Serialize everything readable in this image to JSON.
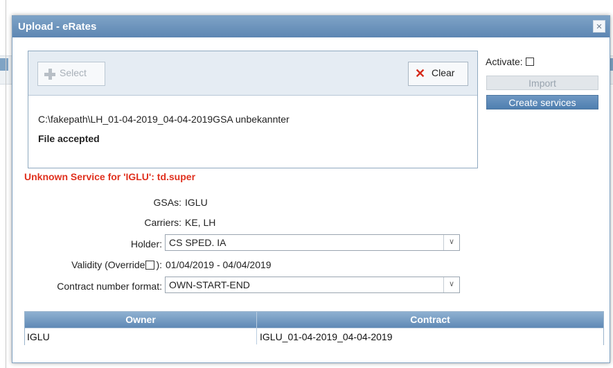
{
  "dialog": {
    "title": "Upload - eRates",
    "close_glyph": "×"
  },
  "upload": {
    "select_label": "Select",
    "clear_label": "Clear",
    "file_path": "C:\\fakepath\\LH_01-04-2019_04-04-2019GSA unbekannter",
    "file_status": "File accepted"
  },
  "side": {
    "activate_label": "Activate:",
    "import_label": "Import",
    "create_services_label": "Create services"
  },
  "error_message": "Unknown Service for 'IGLU': td.super",
  "form": {
    "gsas_label": "GSAs:",
    "gsas_value": "IGLU",
    "carriers_label": "Carriers:",
    "carriers_value": "KE, LH",
    "holder_label": "Holder:",
    "holder_value": "CS SPED. IA",
    "validity_label_prefix": "Validity (Override",
    "validity_label_suffix": "):",
    "validity_value": "01/04/2019 - 04/04/2019",
    "contract_format_label": "Contract number format:",
    "contract_format_value": "OWN-START-END"
  },
  "table": {
    "headers": [
      "Owner",
      "Contract"
    ],
    "rows": [
      [
        "IGLU",
        "IGLU_01-04-2019_04-04-2019"
      ]
    ]
  },
  "colors": {
    "title_bar": "#6a91bb",
    "error": "#e0301e",
    "primary_button": "#5c8abb"
  },
  "icons": {
    "select": "plus-icon",
    "clear": "x-icon",
    "close": "close-icon",
    "dropdown": "chevron-down-icon"
  }
}
